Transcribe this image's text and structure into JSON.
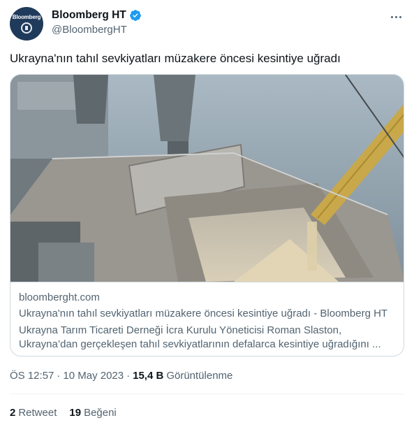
{
  "account": {
    "name": "Bloomberg HT",
    "handle": "@BloombergHT",
    "avatar_text": "Bloomberg"
  },
  "tweet": {
    "text": "Ukrayna'nın tahıl sevkiyatları müzakere öncesi kesintiye uğradı"
  },
  "card": {
    "domain": "bloomberght.com",
    "title": "Ukrayna'nın tahıl sevkiyatları müzakere öncesi kesintiye uğradı - Bloomberg HT",
    "description": "Ukrayna Tarım Ticareti Derneği İcra Kurulu Yöneticisi Roman Slaston, Ukrayna’dan gerçekleşen tahıl sevkiyatlarının defalarca kesintiye uğradığını ..."
  },
  "meta": {
    "time": "ÖS 12:57",
    "separator": "·",
    "date": "10 May 2023",
    "separator2": "·",
    "views_count": "15,4 B",
    "views_label": "Görüntülenme"
  },
  "stats": {
    "retweets_count": "2",
    "retweets_label": "Retweet",
    "likes_count": "19",
    "likes_label": "Beğeni"
  },
  "colors": {
    "verified": "#1d9bf0",
    "secondary_text": "#536471",
    "primary_text": "#0f1419",
    "border": "#cfd9de"
  },
  "icons": {
    "verified": "verified-badge-icon",
    "more": "more-options-icon"
  }
}
